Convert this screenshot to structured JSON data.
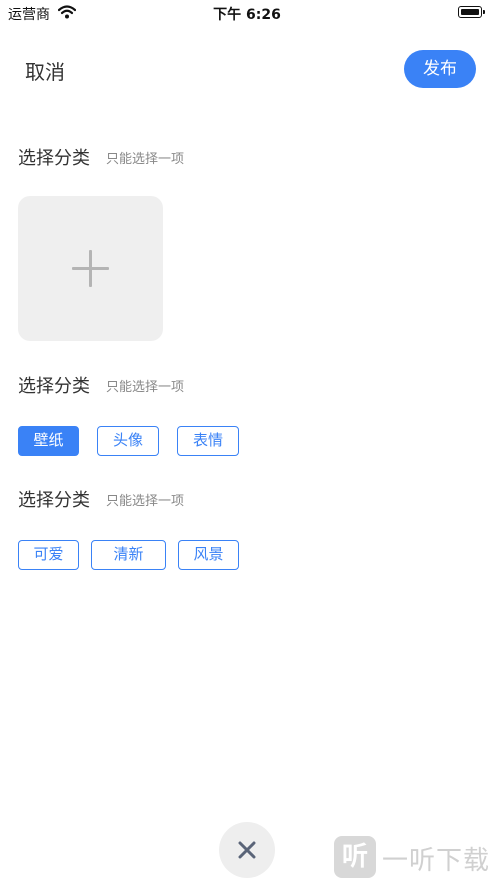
{
  "status_bar": {
    "carrier": "运营商",
    "time": "下午 6:26",
    "wifi_icon": "wifi-icon",
    "battery_icon": "battery-icon"
  },
  "header": {
    "cancel_label": "取消",
    "publish_label": "发布"
  },
  "sections": [
    {
      "title": "选择分类",
      "hint": "只能选择一项"
    },
    {
      "title": "选择分类",
      "hint": "只能选择一项",
      "tags": [
        "壁纸",
        "头像",
        "表情"
      ],
      "selected": "壁纸"
    },
    {
      "title": "选择分类",
      "hint": "只能选择一项",
      "tags": [
        "可爱",
        "清新",
        "风景"
      ]
    }
  ],
  "upload": {
    "icon": "plus-icon"
  },
  "close_button": {
    "icon": "close-icon"
  },
  "watermark": {
    "logo_text": "听",
    "text": "一听下载"
  },
  "colors": {
    "accent": "#3a82f6",
    "upload_bg": "#efefef",
    "fab_bg": "#eeeeee"
  }
}
